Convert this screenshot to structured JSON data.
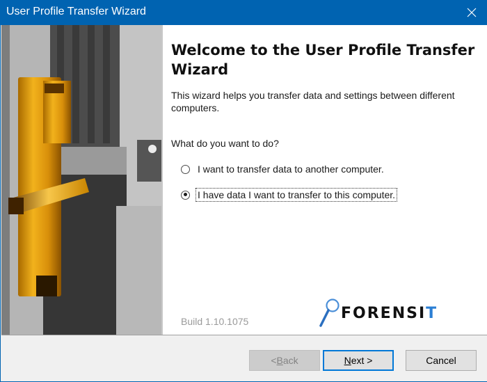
{
  "window": {
    "title": "User Profile Transfer Wizard",
    "close_icon": "close-x-icon"
  },
  "banner": {
    "image": "golden-door-lock-photo"
  },
  "main": {
    "heading": "Welcome to the User Profile Transfer Wizard",
    "intro": "This wizard helps you transfer data and settings between different computers.",
    "question": "What do you want to do?",
    "options": [
      {
        "label": "I want to transfer data to another computer.",
        "selected": false
      },
      {
        "label": "I have data I want to transfer to this computer.",
        "selected": true
      }
    ],
    "build": "Build 1.10.1075",
    "logo": {
      "text_main": "FORENSI",
      "text_accent": "T",
      "icon": "magnifying-glass-icon",
      "accent_color": "#2b7fd4"
    }
  },
  "footer": {
    "back": {
      "prefix": "< ",
      "mnemonic": "B",
      "rest": "ack",
      "enabled": false
    },
    "next": {
      "mnemonic": "N",
      "rest": "ext >",
      "enabled": true,
      "default": true
    },
    "cancel": {
      "label": "Cancel",
      "enabled": true
    }
  },
  "colors": {
    "titlebar": "#0063b1",
    "focus_border": "#0078d7"
  }
}
